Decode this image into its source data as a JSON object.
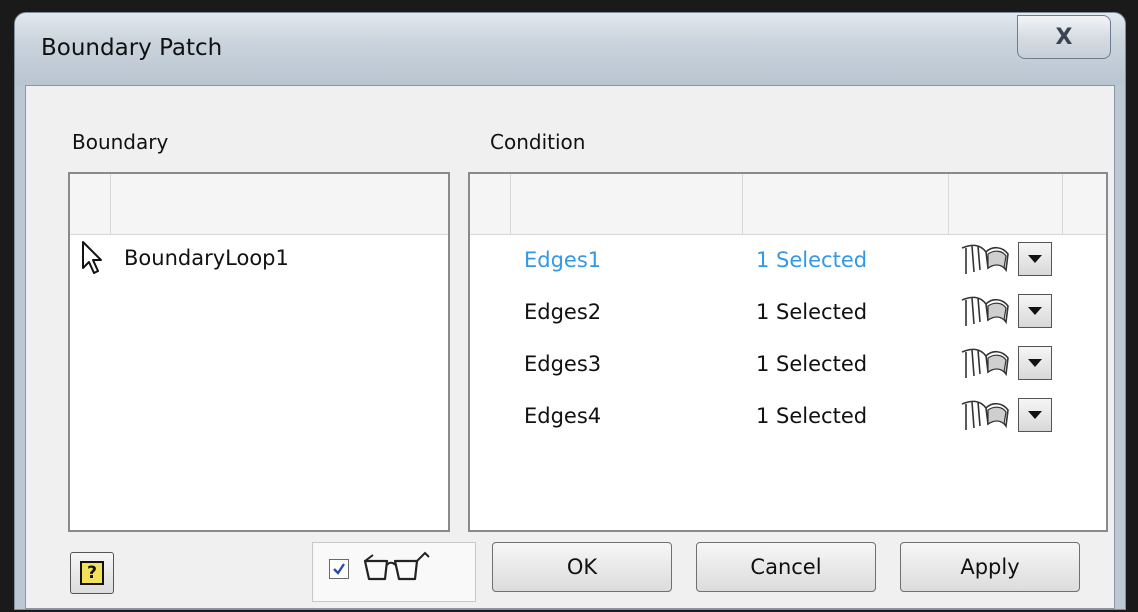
{
  "window": {
    "title": "Boundary Patch",
    "close_label": "X"
  },
  "boundary": {
    "label": "Boundary",
    "items": [
      {
        "name": "BoundaryLoop1",
        "icon": "arrow-cursor-icon"
      }
    ]
  },
  "condition": {
    "label": "Condition",
    "rows": [
      {
        "edges": "Edges1",
        "status": "1 Selected",
        "selected": true,
        "icon": "tangent-condition-icon"
      },
      {
        "edges": "Edges2",
        "status": "1 Selected",
        "selected": false,
        "icon": "tangent-condition-icon"
      },
      {
        "edges": "Edges3",
        "status": "1 Selected",
        "selected": false,
        "icon": "tangent-condition-icon"
      },
      {
        "edges": "Edges4",
        "status": "1 Selected",
        "selected": false,
        "icon": "tangent-condition-icon"
      }
    ]
  },
  "footer": {
    "help_label": "?",
    "preview_checked": true,
    "preview_icon": "glasses-icon",
    "ok_label": "OK",
    "cancel_label": "Cancel",
    "apply_label": "Apply"
  },
  "colors": {
    "selected_text": "#3399e6"
  }
}
